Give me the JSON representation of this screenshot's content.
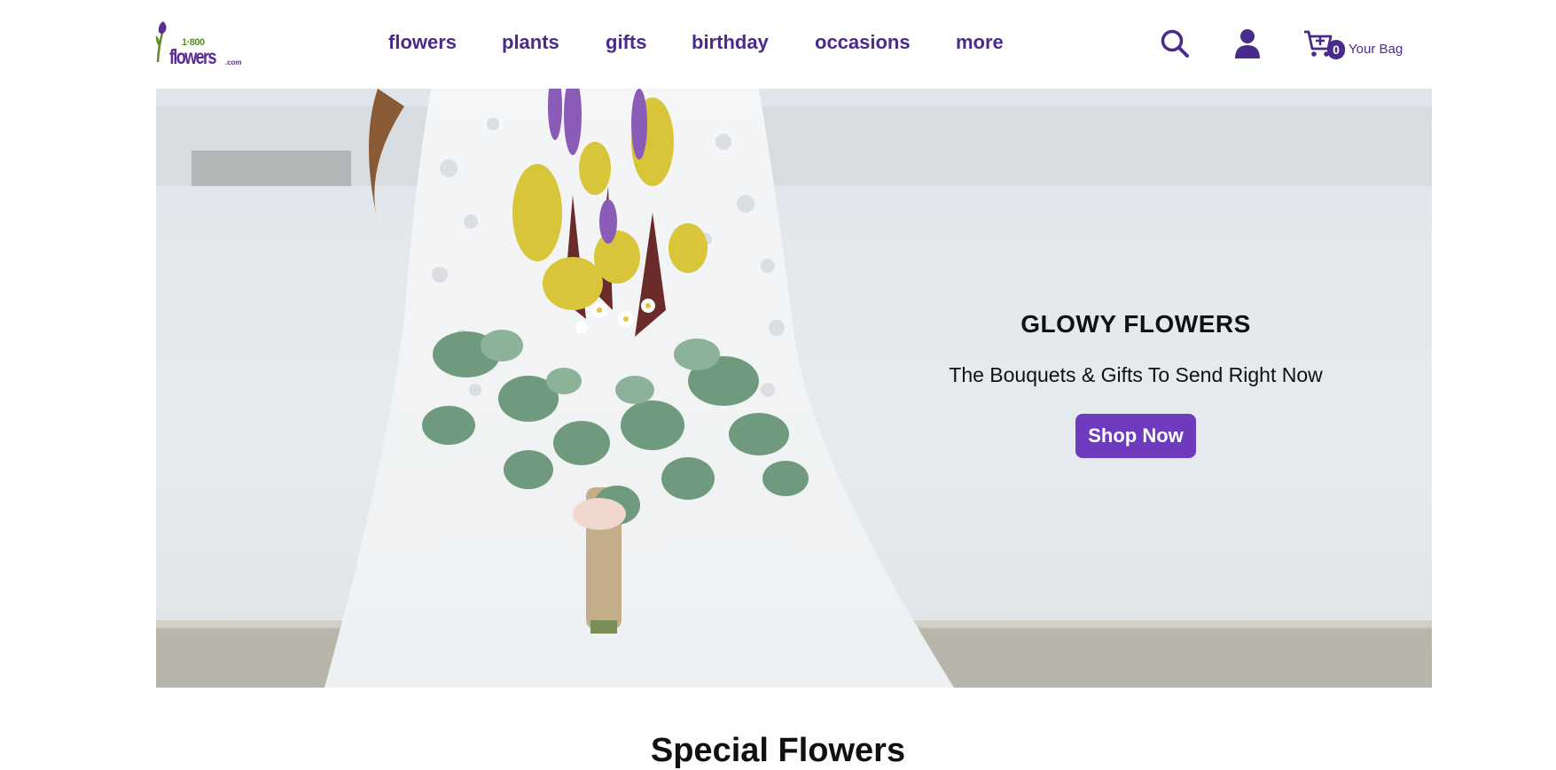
{
  "brand": {
    "logo_number": "1·800",
    "logo_word": "flowers",
    "logo_suffix": ".com",
    "primary_color": "#4a2a8c",
    "button_color": "#6e3bbf",
    "logo_green": "#5b8d2a"
  },
  "nav": {
    "items": [
      "flowers",
      "plants",
      "gifts",
      "birthday",
      "occasions",
      "more"
    ]
  },
  "header": {
    "search_icon": "search-icon",
    "account_icon": "user-icon",
    "cart_icon": "cart-icon",
    "cart_count": "0",
    "bag_label": "Your Bag"
  },
  "hero": {
    "title": "GLOWY FLOWERS",
    "subtitle": "The Bouquets & Gifts To Send Right Now",
    "cta": "Shop Now",
    "image_description": "bride in white lace dress holding a wildflower and eucalyptus bouquet by the water"
  },
  "section": {
    "title": "Special Flowers"
  }
}
